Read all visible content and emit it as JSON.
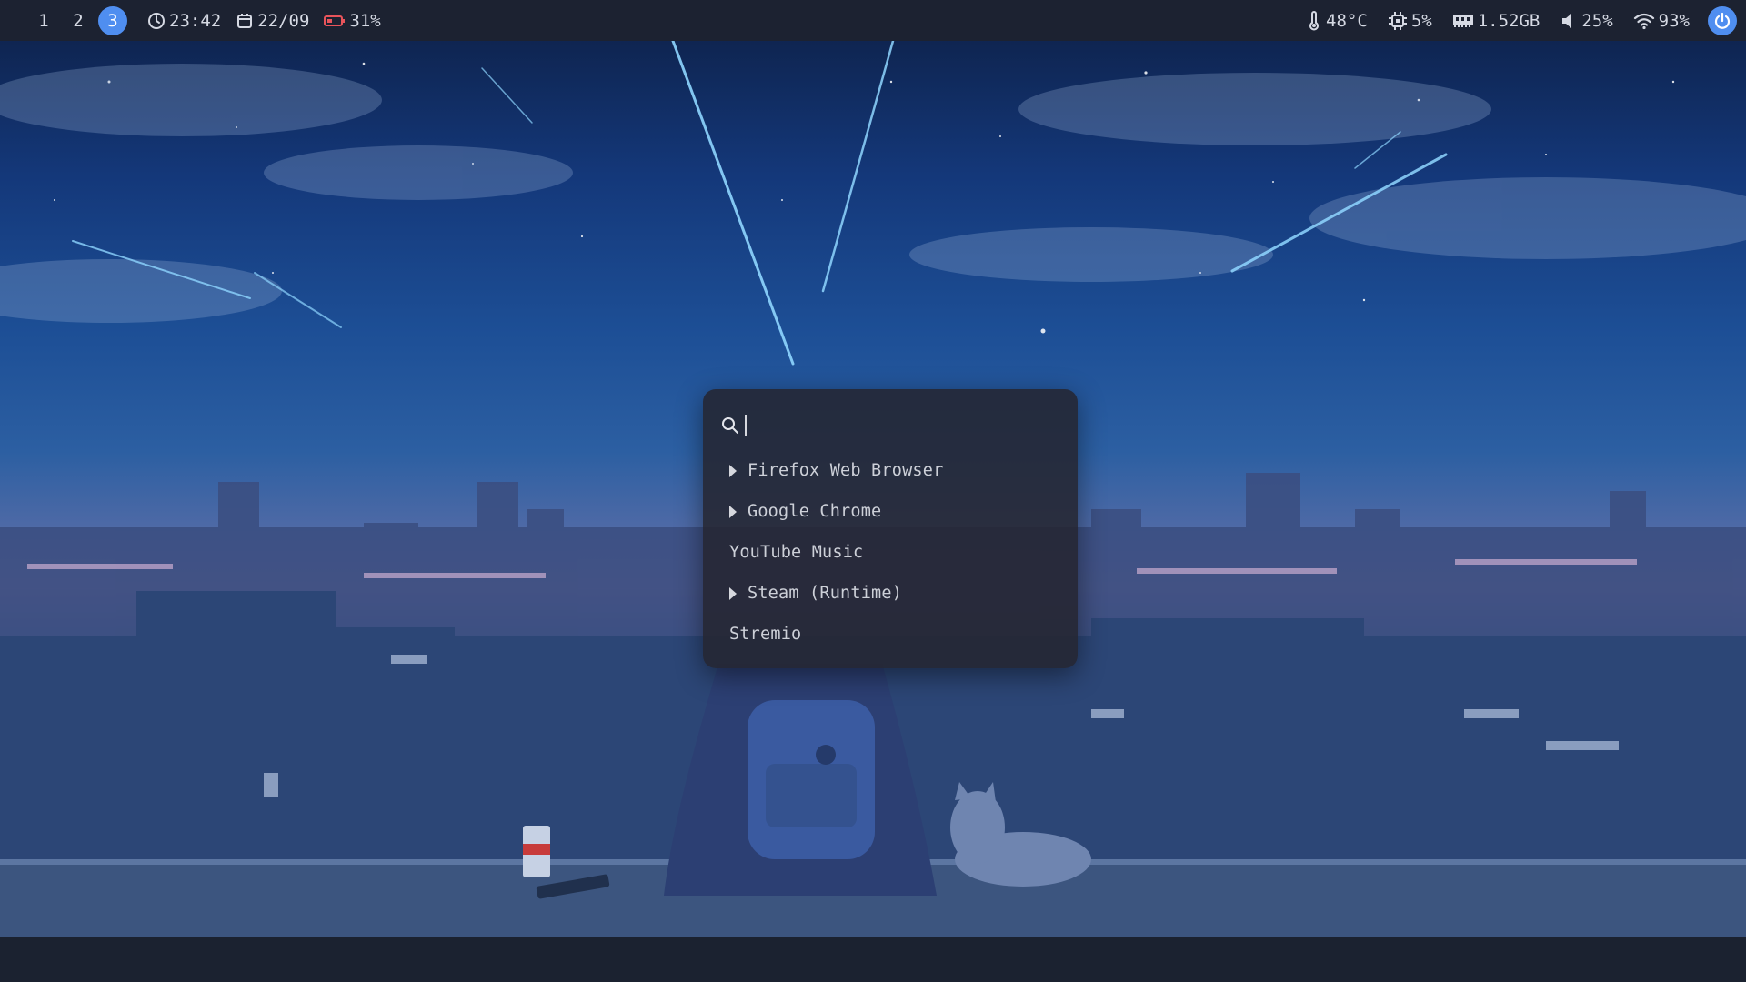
{
  "topbar": {
    "workspaces": [
      {
        "label": "1",
        "active": false
      },
      {
        "label": "2",
        "active": false
      },
      {
        "label": "3",
        "active": true
      }
    ],
    "clock": {
      "icon": "clock-icon",
      "value": "23:42"
    },
    "date": {
      "icon": "calendar-icon",
      "value": "22/09"
    },
    "battery": {
      "icon": "battery-icon",
      "value": "31%"
    },
    "temperature": {
      "icon": "thermometer-icon",
      "value": "48°C"
    },
    "cpu": {
      "icon": "cpu-icon",
      "value": "5%"
    },
    "memory": {
      "icon": "memory-icon",
      "value": "1.52GB"
    },
    "volume": {
      "icon": "speaker-icon",
      "value": "25%"
    },
    "wifi": {
      "icon": "wifi-icon",
      "value": "93%"
    },
    "power": {
      "icon": "power-icon"
    }
  },
  "launcher": {
    "search": {
      "icon": "search-icon",
      "value": "",
      "placeholder": ""
    },
    "results": [
      {
        "label": "Firefox Web Browser",
        "expandable": true
      },
      {
        "label": "Google Chrome",
        "expandable": true
      },
      {
        "label": "YouTube Music",
        "expandable": false
      },
      {
        "label": "Steam (Runtime)",
        "expandable": true
      },
      {
        "label": "Stremio",
        "expandable": false
      }
    ]
  },
  "colors": {
    "bar_bg": "#1c2231",
    "accent": "#4f8ef0",
    "launcher_bg": "#24242e",
    "text": "#d5d9e3"
  }
}
